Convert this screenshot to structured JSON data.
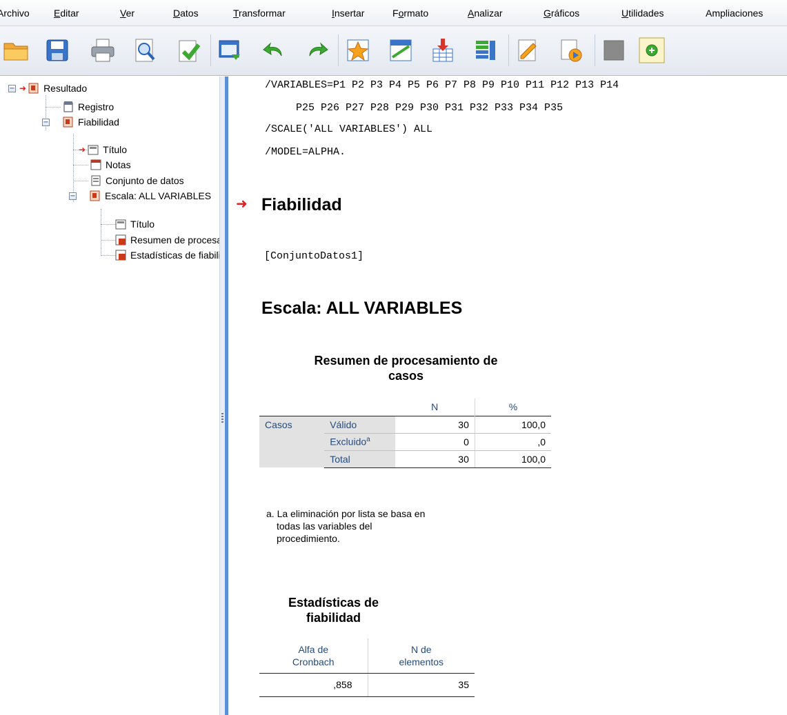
{
  "menu": [
    {
      "pre": "",
      "ul": "",
      "post": "Archivo"
    },
    {
      "pre": "",
      "ul": "E",
      "post": "ditar"
    },
    {
      "pre": "",
      "ul": "V",
      "post": "er"
    },
    {
      "pre": "",
      "ul": "D",
      "post": "atos"
    },
    {
      "pre": "",
      "ul": "T",
      "post": "ransformar"
    },
    {
      "pre": "",
      "ul": "I",
      "post": "nsertar"
    },
    {
      "pre": "F",
      "ul": "o",
      "post": "rmato"
    },
    {
      "pre": "",
      "ul": "A",
      "post": "nalizar"
    },
    {
      "pre": "",
      "ul": "G",
      "post": "ráficos"
    },
    {
      "pre": "",
      "ul": "U",
      "post": "tilidades"
    },
    {
      "pre": "",
      "ul": "",
      "post": "Ampliaciones"
    }
  ],
  "toolbar": [
    "open-folder-icon",
    "save-icon",
    "print-icon",
    "print-preview-icon",
    "export-icon",
    "goto-data-icon",
    "undo-icon",
    "redo-icon",
    "goto-case-icon",
    "goto-variable-icon",
    "insert-cases-icon",
    "variables-icon",
    "designate-window-icon",
    "run-script-icon",
    "gray-box-icon",
    "add-icon"
  ],
  "navigator": {
    "root": "Resultado",
    "registro": "Registro",
    "fiabilidad": "Fiabilidad",
    "titulo1": "Título",
    "notas": "Notas",
    "conjunto": "Conjunto de datos",
    "escala": "Escala: ALL VARIABLES",
    "titulo2": "Título",
    "resumen": "Resumen de procesamiento de casos",
    "estadisticas": "Estadísticas de fiabilidad"
  },
  "output": {
    "syntax": [
      "/VARIABLES=P1 P2 P3 P4 P5 P6 P7 P8 P9 P10 P11 P12 P13 P14",
      "  P25 P26 P27 P28 P29 P30 P31 P32 P33 P34 P35",
      "/SCALE('ALL VARIABLES') ALL",
      "/MODEL=ALPHA."
    ],
    "heading": "Fiabilidad",
    "dataset": "[ConjuntoDatos1]",
    "scale_heading": "Escala: ALL VARIABLES",
    "case_table": {
      "title_line1": "Resumen de procesamiento de",
      "title_line2": "casos",
      "col_n": "N",
      "col_pct": "%",
      "group": "Casos",
      "rows": [
        {
          "label": "Válido",
          "sup": "",
          "n": "30",
          "pct": "100,0"
        },
        {
          "label": "Excluido",
          "sup": "a",
          "n": "0",
          "pct": ",0"
        },
        {
          "label": "Total",
          "sup": "",
          "n": "30",
          "pct": "100,0"
        }
      ],
      "footnote": [
        "a. La eliminación por lista se basa en",
        "todas las variables del",
        "procedimiento."
      ]
    },
    "reliability_table": {
      "title_line1": "Estadísticas de",
      "title_line2": "fiabilidad",
      "col1_line1": "Alfa de",
      "col1_line2": "Cronbach",
      "col2_line1": "N de",
      "col2_line2": "elementos",
      "alpha": ",858",
      "n_items": "35"
    }
  }
}
